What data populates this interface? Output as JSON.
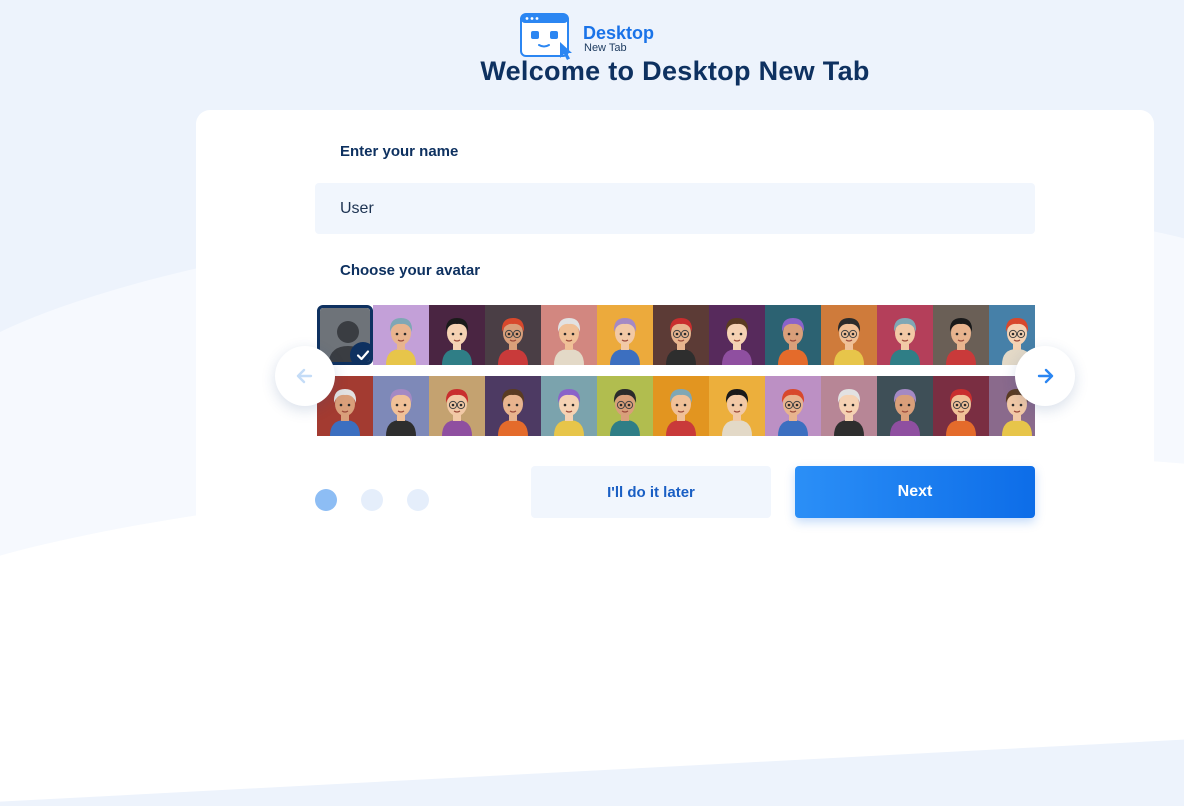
{
  "logo": {
    "line1": "Desktop",
    "line2": "New Tab"
  },
  "title": "Welcome to Desktop New Tab",
  "form": {
    "name_label": "Enter your name",
    "name_value": "User",
    "avatar_label": "Choose your avatar"
  },
  "avatars": {
    "selected_index": 0,
    "row1": [
      {
        "name": "default-silhouette",
        "bg": "#6e7379"
      },
      {
        "name": "avatar-2",
        "bg": "#c3a0d8"
      },
      {
        "name": "avatar-3",
        "bg": "#4a2542"
      },
      {
        "name": "avatar-4",
        "bg": "#4a3e45"
      },
      {
        "name": "avatar-5",
        "bg": "#d28780"
      },
      {
        "name": "avatar-6",
        "bg": "#ecaa3c"
      },
      {
        "name": "avatar-7",
        "bg": "#5c3b36"
      },
      {
        "name": "avatar-8",
        "bg": "#572a5c"
      },
      {
        "name": "avatar-9",
        "bg": "#2c6272"
      },
      {
        "name": "avatar-10",
        "bg": "#cf7b3b"
      },
      {
        "name": "avatar-11",
        "bg": "#b43f5a"
      },
      {
        "name": "avatar-12",
        "bg": "#6a5f56"
      },
      {
        "name": "avatar-13",
        "bg": "#4680a8"
      }
    ],
    "row2": [
      {
        "name": "avatar-14",
        "bg": "#a33b31"
      },
      {
        "name": "avatar-15",
        "bg": "#7e89b8"
      },
      {
        "name": "avatar-16",
        "bg": "#c4a270"
      },
      {
        "name": "avatar-17",
        "bg": "#4d3a63"
      },
      {
        "name": "avatar-18",
        "bg": "#7ba3ad"
      },
      {
        "name": "avatar-19",
        "bg": "#b1bd4f"
      },
      {
        "name": "avatar-20",
        "bg": "#e29520"
      },
      {
        "name": "avatar-21",
        "bg": "#ecaf3c"
      },
      {
        "name": "avatar-22",
        "bg": "#bc90c4"
      },
      {
        "name": "avatar-23",
        "bg": "#b78696"
      },
      {
        "name": "avatar-24",
        "bg": "#3e4f57"
      },
      {
        "name": "avatar-25",
        "bg": "#7a2e42"
      },
      {
        "name": "avatar-26",
        "bg": "#8a6a8c"
      }
    ]
  },
  "pagination": {
    "total": 3,
    "active": 0
  },
  "buttons": {
    "later": "I'll do it later",
    "next": "Next"
  },
  "colors": {
    "primary": "#1a73e8",
    "navy": "#0e3160",
    "input_bg": "#f1f6fd",
    "dot_active": "#8dbdf4",
    "dot_inactive": "#e5eefb"
  },
  "icons": {
    "prev": "arrow-left-icon",
    "next": "arrow-right-icon",
    "selected": "check-icon"
  }
}
